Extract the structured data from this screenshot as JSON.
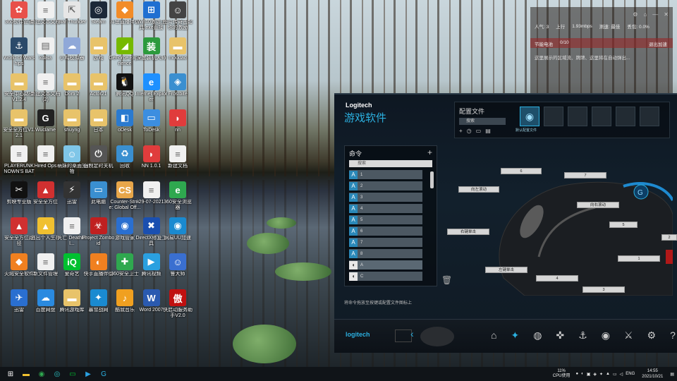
{
  "desktop": {
    "icons": [
      {
        "label": "360软件管家",
        "color": "#e8504a",
        "glyph": "✿"
      },
      {
        "label": "新建文本文档",
        "color": "#f0f0f0",
        "glyph": "≡"
      },
      {
        "label": "War Thunder",
        "color": "#e6e6e6",
        "glyph": "⇱"
      },
      {
        "label": "Steam",
        "color": "#1b2838",
        "glyph": "◎"
      },
      {
        "label": "斗鱼直播伴侣",
        "color": "#f28c28",
        "glyph": "◆"
      },
      {
        "label": "Win10激活工具.exe直接",
        "color": "#1f6fd1",
        "glyph": "⊞"
      },
      {
        "label": "图片传奇击起你的激励",
        "color": "#444",
        "glyph": "☺"
      },
      {
        "label": "World of Warships",
        "color": "#2b4a6a",
        "glyph": "⚓"
      },
      {
        "label": "kdata",
        "color": "#f0f0f0",
        "glyph": "▤"
      },
      {
        "label": "小鸡模拟器",
        "color": "#8fa8d8",
        "glyph": "☁"
      },
      {
        "label": "游戏",
        "color": "#e8c36a",
        "glyph": "▬"
      },
      {
        "label": "GeForce Experience",
        "color": "#76b900",
        "glyph": "◢"
      },
      {
        "label": "深度装机大师",
        "color": "#2c9a3c",
        "glyph": "装"
      },
      {
        "label": "moudao",
        "color": "#e8c36a",
        "glyph": "▬"
      },
      {
        "label": "安全中心路径V1.2.4",
        "color": "#e8c36a",
        "glyph": "▬"
      },
      {
        "label": "新建文本文档(2)",
        "color": "#f0f0f0",
        "glyph": "≡"
      },
      {
        "label": "Dorti 2",
        "color": "#e8c36a",
        "glyph": "▬"
      },
      {
        "label": "Actor21",
        "color": "#e8c36a",
        "glyph": "▬"
      },
      {
        "label": "腾讯QQ",
        "color": "#111",
        "glyph": "🐧"
      },
      {
        "label": "Internet Explorer",
        "color": "#1e90ff",
        "glyph": "e"
      },
      {
        "label": "Frostbite",
        "color": "#3a8fd0",
        "glyph": "◈"
      },
      {
        "label": "安全全方位V1.2.1",
        "color": "#e8c36a",
        "glyph": "▬"
      },
      {
        "label": "Wuclame",
        "color": "#222",
        "glyph": "G"
      },
      {
        "label": "shuyng",
        "color": "#e8c36a",
        "glyph": "▬"
      },
      {
        "label": "日本",
        "color": "#e8c36a",
        "glyph": "▬"
      },
      {
        "label": "oDesk",
        "color": "#2a7ad0",
        "glyph": "◧"
      },
      {
        "label": "ToDesk",
        "color": "#3c8ee0",
        "glyph": "▭"
      },
      {
        "label": "nn",
        "color": "#e03c3c",
        "glyph": "◗"
      },
      {
        "label": "PLAYERUNKNOWN'S BATTLEGROUNDS",
        "color": "#f0f0f0",
        "glyph": "≡"
      },
      {
        "label": "Hired Ops",
        "color": "#f0f0f0",
        "glyph": "≡"
      },
      {
        "label": "萌妹的桌面宠物",
        "color": "#7fc6e8",
        "glyph": "☺"
      },
      {
        "label": "强制定时关机",
        "color": "#555",
        "glyph": "⏻"
      },
      {
        "label": "回收",
        "color": "#3a8fd0",
        "glyph": "♻"
      },
      {
        "label": "NN 1.0.1",
        "color": "#e03c3c",
        "glyph": "◗"
      },
      {
        "label": "新建文档",
        "color": "#f0f0f0",
        "glyph": "≡"
      },
      {
        "label": "剪映专业版",
        "color": "#111",
        "glyph": "✂"
      },
      {
        "label": "安全全方位",
        "color": "#d03030",
        "glyph": "▲"
      },
      {
        "label": "迅雷",
        "color": "#333",
        "glyph": "⚡"
      },
      {
        "label": "此电脑",
        "color": "#3a8fd0",
        "glyph": "▭"
      },
      {
        "label": "Counter-Strike: Global Off...",
        "color": "#e8a64a",
        "glyph": "CS"
      },
      {
        "label": "29-07-2021",
        "color": "#f0f0f0",
        "glyph": "≡"
      },
      {
        "label": "360安全浏览器",
        "color": "#2fa84f",
        "glyph": "e"
      },
      {
        "label": "安全全方位路径",
        "color": "#d03030",
        "glyph": "▲"
      },
      {
        "label": "逃出个人生存",
        "color": "#f0c030",
        "glyph": "▲"
      },
      {
        "label": "死亡 Deathkill...",
        "color": "#f0f0f0",
        "glyph": "≡"
      },
      {
        "label": "Project Zomboid",
        "color": "#c02020",
        "glyph": "☣"
      },
      {
        "label": "游戏管家",
        "color": "#2a6fd0",
        "glyph": "◉"
      },
      {
        "label": "DirectX修复工具",
        "color": "#1a4fb0",
        "glyph": "✖"
      },
      {
        "label": "网易UU加速",
        "color": "#1a8ad0",
        "glyph": "◉"
      },
      {
        "label": "火绒安全软件",
        "color": "#f08020",
        "glyph": "◆"
      },
      {
        "label": "新文件管理",
        "color": "#f0f0f0",
        "glyph": "≡"
      },
      {
        "label": "爱奇艺",
        "color": "#00c030",
        "glyph": "iQ"
      },
      {
        "label": "快手直播伴侣",
        "color": "#f08020",
        "glyph": "◐"
      },
      {
        "label": "360安全卫士",
        "color": "#2fa84f",
        "glyph": "✚"
      },
      {
        "label": "腾讯视频",
        "color": "#2aa0e0",
        "glyph": "▶"
      },
      {
        "label": "鲁大师",
        "color": "#3a6fd0",
        "glyph": "☺"
      },
      {
        "label": "迅雷",
        "color": "#2a6fd0",
        "glyph": "✈"
      },
      {
        "label": "百度网盘",
        "color": "#2a8ae0",
        "glyph": "☁"
      },
      {
        "label": "腾讯游戏库",
        "color": "#e8c36a",
        "glyph": "▬"
      },
      {
        "label": "暴雪战网",
        "color": "#1a8ad0",
        "glyph": "✦"
      },
      {
        "label": "酷我音乐",
        "color": "#f0a020",
        "glyph": "♪"
      },
      {
        "label": "Word 2007",
        "color": "#2a5ab0",
        "glyph": "W"
      },
      {
        "label": "快启动服务助手V2.0",
        "color": "#c01010",
        "glyph": "傲"
      }
    ]
  },
  "net_widget": {
    "users": "人气: 3",
    "upload": "上行",
    "upload_val": "1.93mbps",
    "latency": "测速: 最佳",
    "loss": "丢包: 0.0%",
    "power": "节能电池",
    "progress": "0/10",
    "btn": "退出加速",
    "notice": "这里展示的区域流、牌牌、这里将在自动弹出..."
  },
  "logitech": {
    "brand": "Logitech",
    "title": "游戏软件",
    "profile_title": "配置文件",
    "profile_search": "搜索",
    "profile_default": "默认配置文件",
    "commands_title": "命令",
    "commands_search": "搜索",
    "commands": [
      "1",
      "2",
      "3",
      "4",
      "5",
      "6",
      "7",
      "8",
      "A",
      "C"
    ],
    "hint": "将命令拖放至按键或配置文件图标上",
    "callouts": [
      "6",
      "7",
      "向左滚动",
      "向右滚动",
      "5",
      "右键单击",
      "2",
      "1",
      "左键单击",
      "4",
      "3"
    ],
    "footer_logo": "logitech"
  },
  "taskbar": {
    "cpu_percent": "11%",
    "cpu_label": "CPU使用",
    "lang": "ENG",
    "time": "14:55",
    "date": "2021/10/21"
  }
}
